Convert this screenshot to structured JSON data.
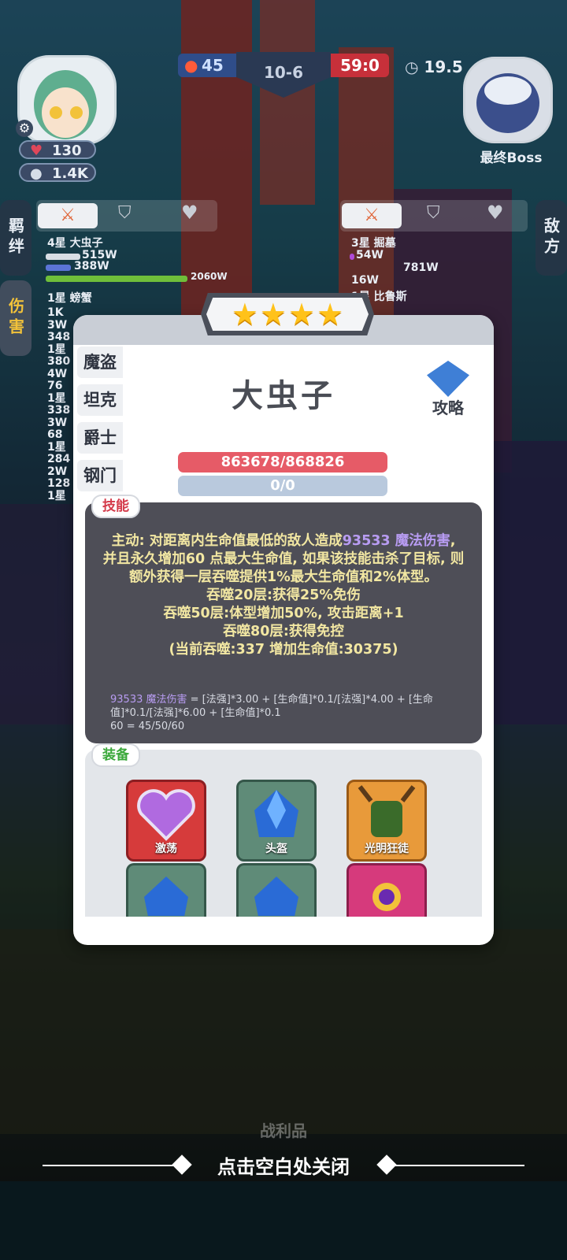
{
  "hud": {
    "player_level": "130",
    "player_power": "1.4K",
    "fire_count": "45",
    "stage": "10-6",
    "score": "59:0",
    "timer": "19.5",
    "boss_label": "最终Boss"
  },
  "side_tabs": {
    "bond": "羁绊",
    "enemy": "敌方",
    "damage": "伤害"
  },
  "left_panel": {
    "unit_name": "4星 大虫子",
    "dmg1": "515W",
    "dmg2": "388W",
    "dmg3": "2060W",
    "unit2": "1星 螃蟹",
    "list": [
      "1K",
      "3W",
      "348",
      "1星",
      "380",
      "4W",
      "76",
      "1星",
      "338",
      "3W",
      "68",
      "1星",
      "284",
      "2W",
      "128",
      "1星"
    ]
  },
  "right_panel": {
    "unit_name": "3星 掘墓",
    "dmg1": "54W",
    "dmg2": "781W",
    "dmg3": "16W",
    "unit2": "1星 比鲁斯"
  },
  "modal": {
    "stars": [
      "★",
      "★",
      "★",
      "★"
    ],
    "tabs": [
      "魔盗",
      "坦克",
      "爵士",
      "钢门"
    ],
    "hero_name": "大虫子",
    "guide_label": "攻略",
    "hp": "863678/868826",
    "mp": "0/0",
    "skill_label": "技能",
    "skill": {
      "p1": "主动: 对距离内生命值最低的敌人造成",
      "p1_hl": "93533 魔法伤害",
      "p2": ", 并且永久增加60 点最大生命值, 如果该技能击杀了目标, 则额外获得一层吞噬提供1%最大生命值和2%体型。",
      "l1": "吞噬20层:获得25%免伤",
      "l2": "吞噬50层:体型增加50%, 攻击距离+1",
      "l3": "吞噬80层:获得免控",
      "l4": "(当前吞噬:337 增加生命值:30375)"
    },
    "formula": {
      "a": "93533 魔法伤害",
      "b": "= [法强]*3.00 + [生命值]*0.1/[法强]*4.00 + [生命值]*0.1/[法强]*6.00 + [生命值]*0.1",
      "c": "60",
      "d": "= 45/50/60"
    },
    "equip_label": "装备",
    "items": [
      {
        "name": "激荡",
        "color": "#d63b3b"
      },
      {
        "name": "头盔",
        "color": "#5f8b78"
      },
      {
        "name": "光明狂徒",
        "color": "#e89a3a"
      },
      {
        "name": "",
        "color": "#5f8b78"
      },
      {
        "name": "",
        "color": "#5f8b78"
      },
      {
        "name": "",
        "color": "#d63a7c"
      }
    ]
  },
  "bottom": {
    "loot_label": "战利品",
    "close_hint": "点击空白处关闭"
  }
}
